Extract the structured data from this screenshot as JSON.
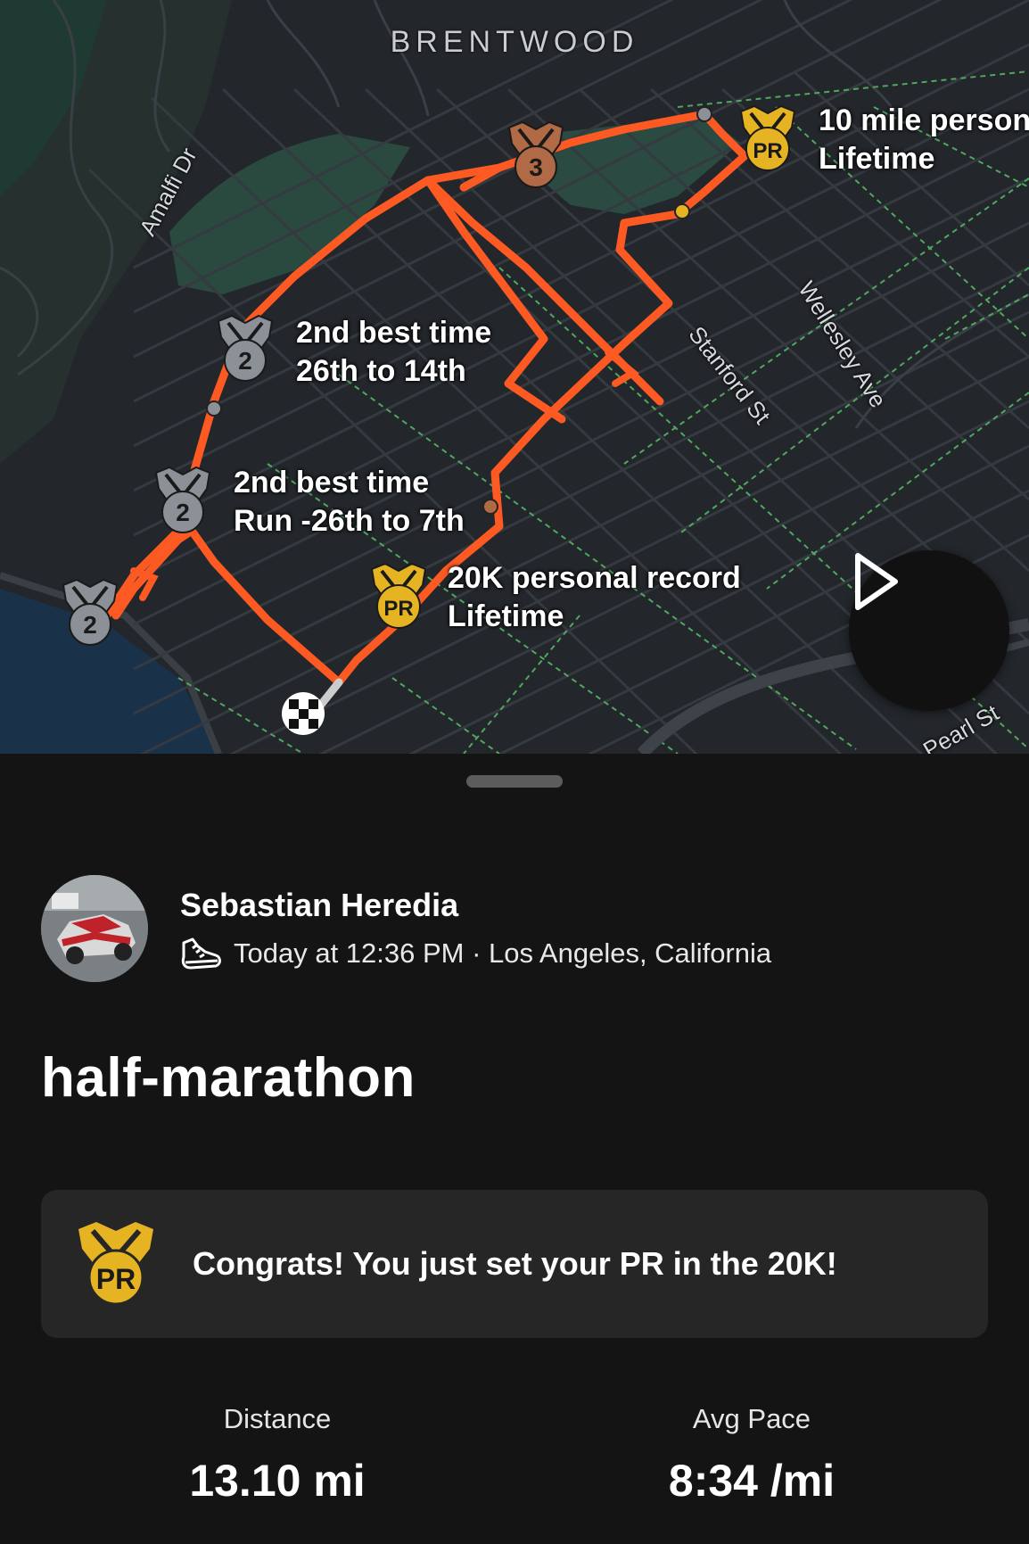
{
  "map": {
    "neighborhood": "BRENTWOOD",
    "streets": [
      "Amalfi Dr",
      "Stanford St",
      "Wellesley Ave",
      "Pearl St"
    ],
    "annotations": [
      {
        "line1": "10 mile person",
        "line2": "Lifetime",
        "medal": "PR"
      },
      {
        "line1": "2nd best time",
        "line2": "26th to 14th",
        "medal": "2"
      },
      {
        "line1": "2nd best time",
        "line2": "Run -26th to 7th",
        "medal": "2"
      },
      {
        "line1": "20K personal record",
        "line2": "Lifetime",
        "medal": "PR"
      }
    ],
    "medals": {
      "bronze_rank": "3",
      "silver_rank": "2",
      "pr_label": "PR"
    },
    "colors": {
      "route": "#fc5a22",
      "pr_gold": "#e6b423",
      "silver": "#8b9196",
      "bronze": "#b06a45",
      "street_green": "#55b86a"
    },
    "play_icon": "play-icon",
    "finish_icon": "checkered-flag-icon"
  },
  "athlete": {
    "name": "Sebastian Heredia",
    "meta": "Today at 12:36 PM · Los Angeles, California",
    "activity_icon": "running-shoe-icon"
  },
  "activity": {
    "title": "half-marathon"
  },
  "pr_banner": {
    "text": "Congrats! You just set your PR in the 20K!",
    "icon": "pr-medal-icon"
  },
  "stats": [
    {
      "label": "Distance",
      "value": "13.10 mi"
    },
    {
      "label": "Avg Pace",
      "value": "8:34 /mi"
    }
  ]
}
